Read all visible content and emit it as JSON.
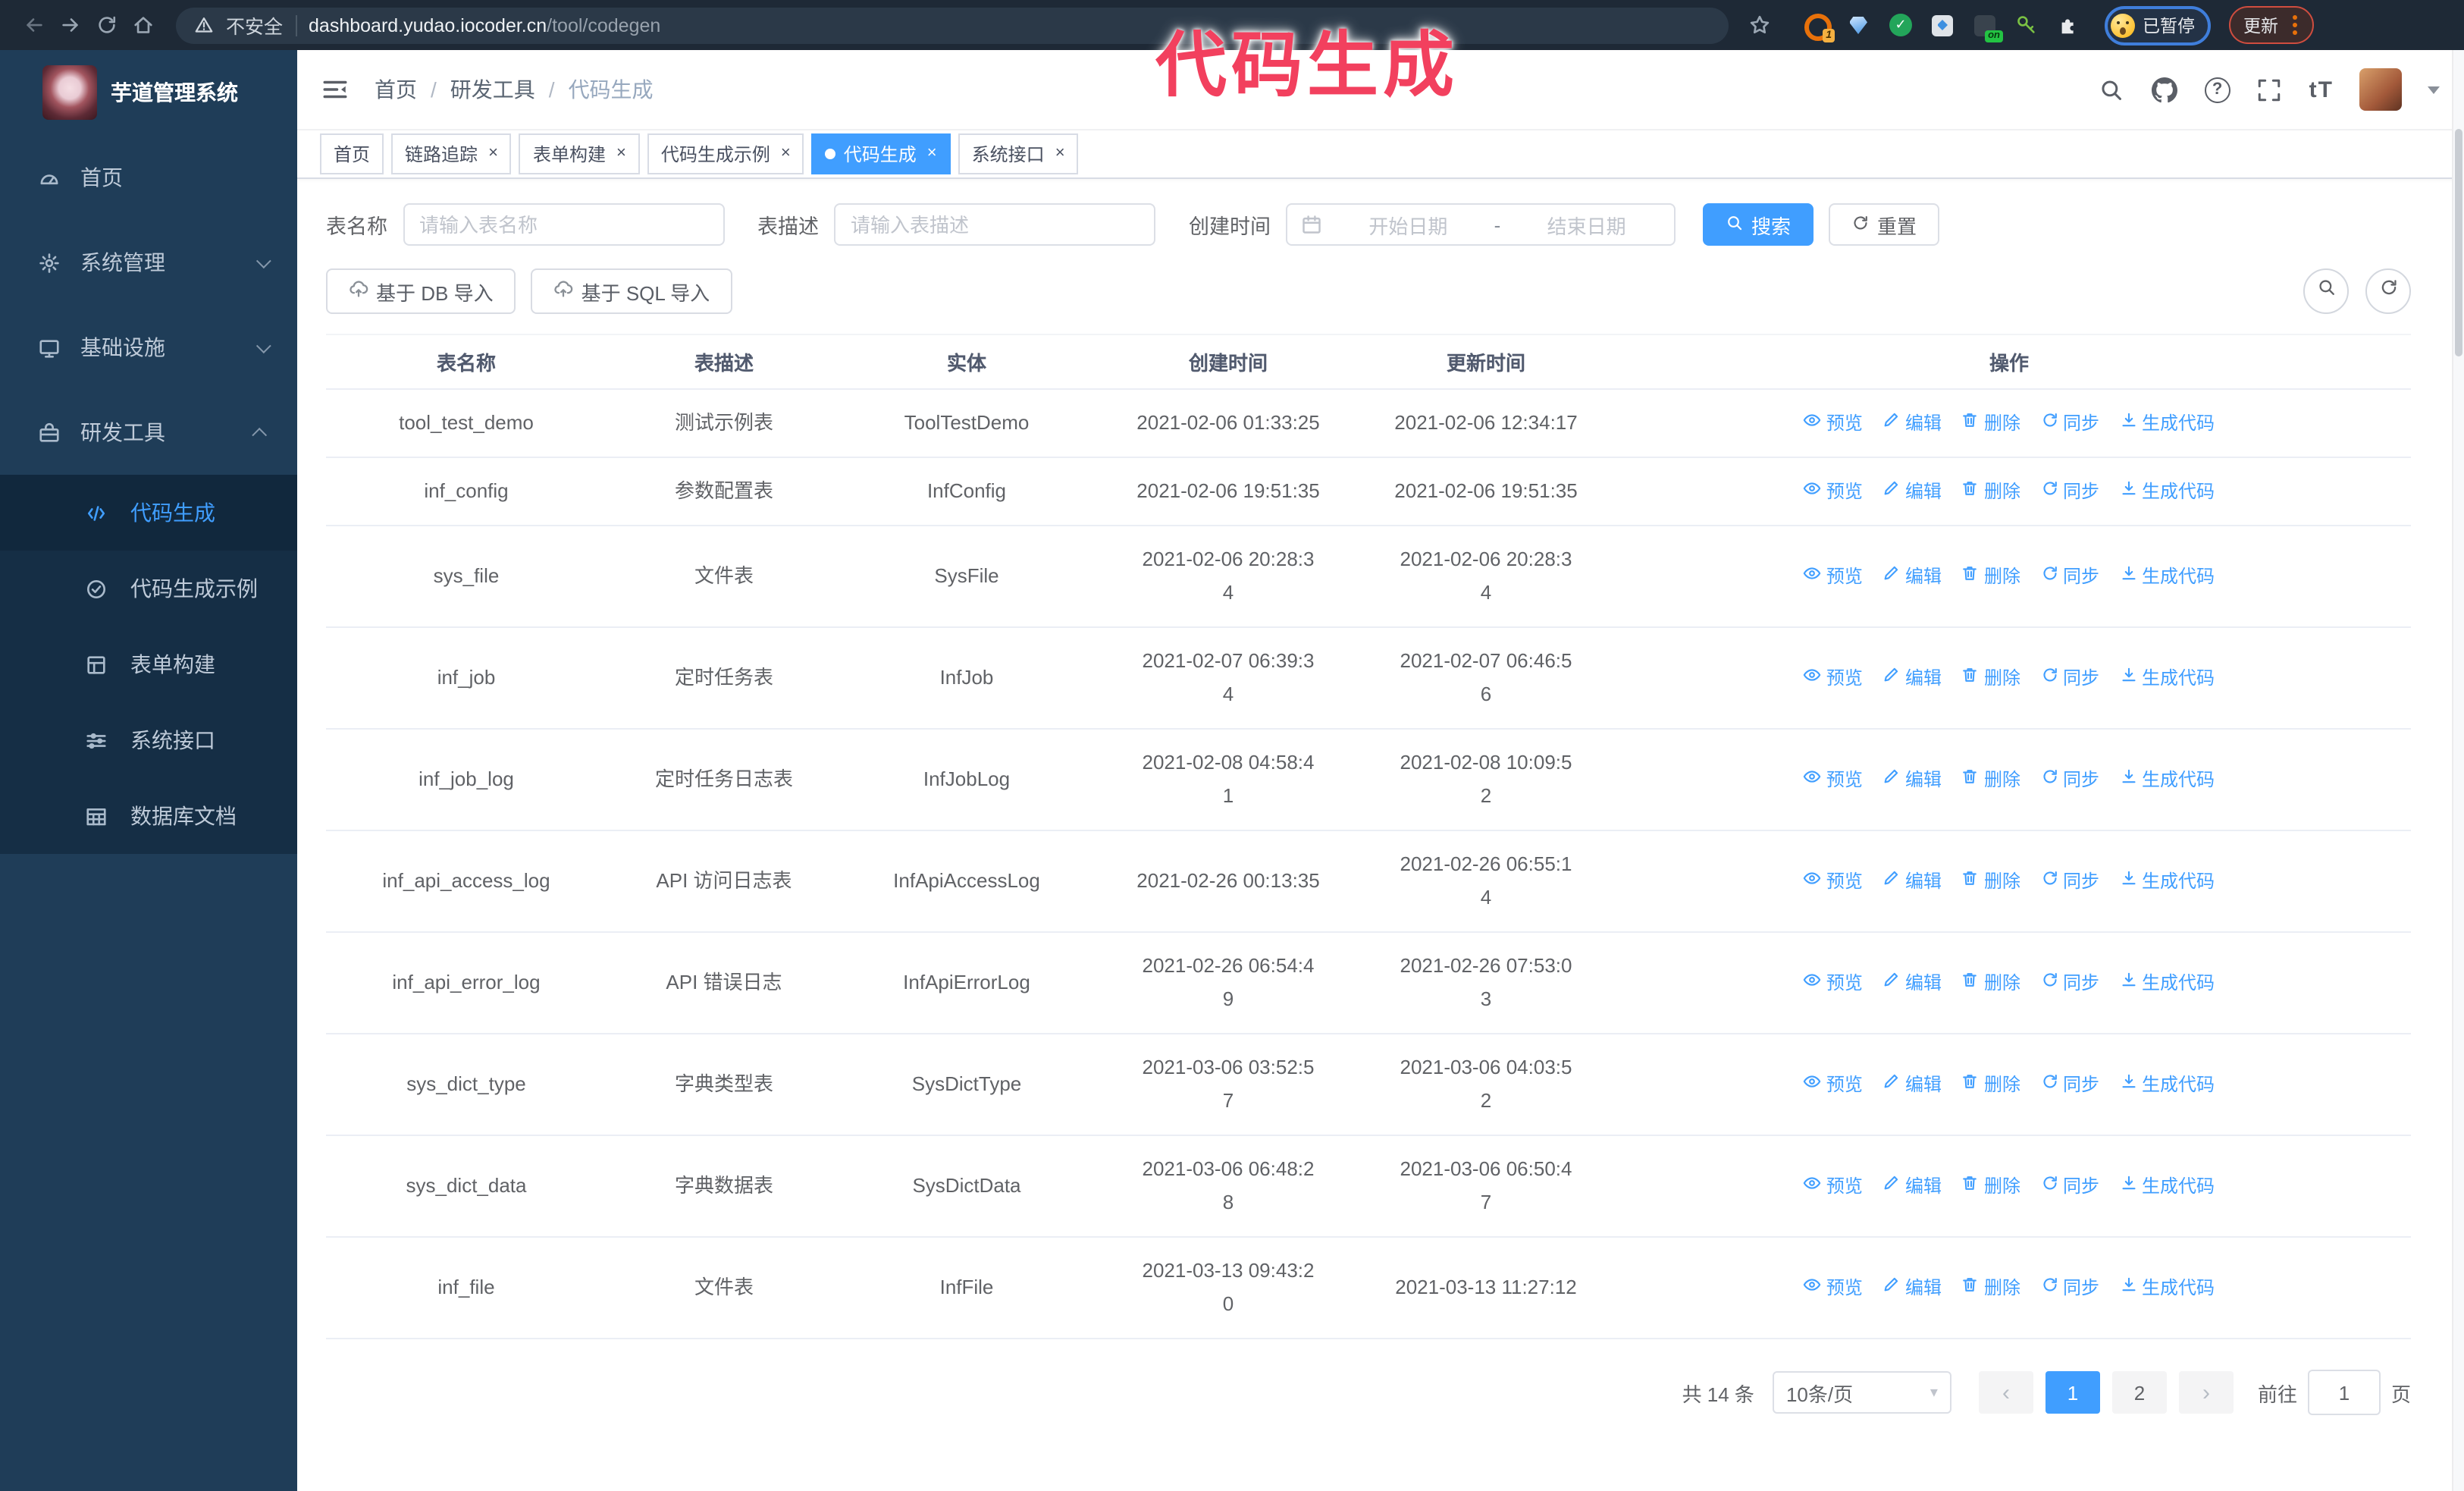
{
  "colors": {
    "accent": "#409eff",
    "annotation": "#f2405e",
    "sidebar_bg": "#1f3d58",
    "submenu_bg": "#152e45",
    "browser_bar_bg": "#1e2936"
  },
  "annotation": {
    "text": "代码生成"
  },
  "browser": {
    "security_label": "不安全",
    "url_host": "dashboard.yudao.iocoder.cn",
    "url_path": "/tool/codegen",
    "ext_badge": "1",
    "ext_on_label": "on",
    "profile_status": "已暂停",
    "update_label": "更新"
  },
  "sidebar": {
    "title": "芋道管理系统",
    "menu": [
      {
        "label": "首页",
        "icon": "dashboard-icon",
        "chevron": null
      },
      {
        "label": "系统管理",
        "icon": "gear-icon",
        "chevron": "down"
      },
      {
        "label": "基础设施",
        "icon": "monitor-icon",
        "chevron": "down"
      },
      {
        "label": "研发工具",
        "icon": "toolbox-icon",
        "chevron": "up"
      }
    ],
    "submenu": [
      {
        "label": "代码生成",
        "icon": "code-icon",
        "active": true
      },
      {
        "label": "代码生成示例",
        "icon": "badge-check-icon",
        "active": false
      },
      {
        "label": "表单构建",
        "icon": "form-icon",
        "active": false
      },
      {
        "label": "系统接口",
        "icon": "sliders-icon",
        "active": false
      },
      {
        "label": "数据库文档",
        "icon": "table-grid-icon",
        "active": false
      }
    ]
  },
  "header": {
    "breadcrumb": [
      "首页",
      "研发工具",
      "代码生成"
    ]
  },
  "tabs": [
    {
      "label": "首页",
      "closable": false,
      "active": false
    },
    {
      "label": "链路追踪",
      "closable": true,
      "active": false
    },
    {
      "label": "表单构建",
      "closable": true,
      "active": false
    },
    {
      "label": "代码生成示例",
      "closable": true,
      "active": false
    },
    {
      "label": "代码生成",
      "closable": true,
      "active": true
    },
    {
      "label": "系统接口",
      "closable": true,
      "active": false
    }
  ],
  "filters": {
    "name_label": "表名称",
    "name_placeholder": "请输入表名称",
    "desc_label": "表描述",
    "desc_placeholder": "请输入表描述",
    "time_label": "创建时间",
    "start_placeholder": "开始日期",
    "range_separator": "-",
    "end_placeholder": "结束日期",
    "search_label": "搜索",
    "reset_label": "重置"
  },
  "toolbar": {
    "import_db_label": "基于 DB 导入",
    "import_sql_label": "基于 SQL 导入"
  },
  "table": {
    "columns": [
      "表名称",
      "表描述",
      "实体",
      "创建时间",
      "更新时间",
      "操作"
    ],
    "actions": [
      {
        "label": "预览",
        "icon": "eye-icon"
      },
      {
        "label": "编辑",
        "icon": "edit-icon"
      },
      {
        "label": "删除",
        "icon": "delete-icon"
      },
      {
        "label": "同步",
        "icon": "sync-icon"
      },
      {
        "label": "生成代码",
        "icon": "download-icon"
      }
    ],
    "rows": [
      {
        "name": "tool_test_demo",
        "desc": "测试示例表",
        "entity": "ToolTestDemo",
        "created": "2021-02-06 01:33:25",
        "updated": "2021-02-06 12:34:17"
      },
      {
        "name": "inf_config",
        "desc": "参数配置表",
        "entity": "InfConfig",
        "created": "2021-02-06 19:51:35",
        "updated": "2021-02-06 19:51:35"
      },
      {
        "name": "sys_file",
        "desc": "文件表",
        "entity": "SysFile",
        "created": "2021-02-06 20:28:3\n4",
        "updated": "2021-02-06 20:28:3\n4"
      },
      {
        "name": "inf_job",
        "desc": "定时任务表",
        "entity": "InfJob",
        "created": "2021-02-07 06:39:3\n4",
        "updated": "2021-02-07 06:46:5\n6"
      },
      {
        "name": "inf_job_log",
        "desc": "定时任务日志表",
        "entity": "InfJobLog",
        "created": "2021-02-08 04:58:4\n1",
        "updated": "2021-02-08 10:09:5\n2"
      },
      {
        "name": "inf_api_access_log",
        "desc": "API 访问日志表",
        "entity": "InfApiAccessLog",
        "created": "2021-02-26 00:13:35",
        "updated": "2021-02-26 06:55:1\n4"
      },
      {
        "name": "inf_api_error_log",
        "desc": "API 错误日志",
        "entity": "InfApiErrorLog",
        "created": "2021-02-26 06:54:4\n9",
        "updated": "2021-02-26 07:53:0\n3"
      },
      {
        "name": "sys_dict_type",
        "desc": "字典类型表",
        "entity": "SysDictType",
        "created": "2021-03-06 03:52:5\n7",
        "updated": "2021-03-06 04:03:5\n2"
      },
      {
        "name": "sys_dict_data",
        "desc": "字典数据表",
        "entity": "SysDictData",
        "created": "2021-03-06 06:48:2\n8",
        "updated": "2021-03-06 06:50:4\n7"
      },
      {
        "name": "inf_file",
        "desc": "文件表",
        "entity": "InfFile",
        "created": "2021-03-13 09:43:2\n0",
        "updated": "2021-03-13 11:27:12"
      }
    ]
  },
  "pagination": {
    "total": "共 14 条",
    "page_size": "10条/页",
    "prev": "‹",
    "next": "›",
    "pages": [
      {
        "label": "1",
        "active": true
      },
      {
        "label": "2",
        "active": false
      }
    ],
    "goto_label": "前往",
    "goto_value": "1",
    "goto_suffix": "页"
  }
}
